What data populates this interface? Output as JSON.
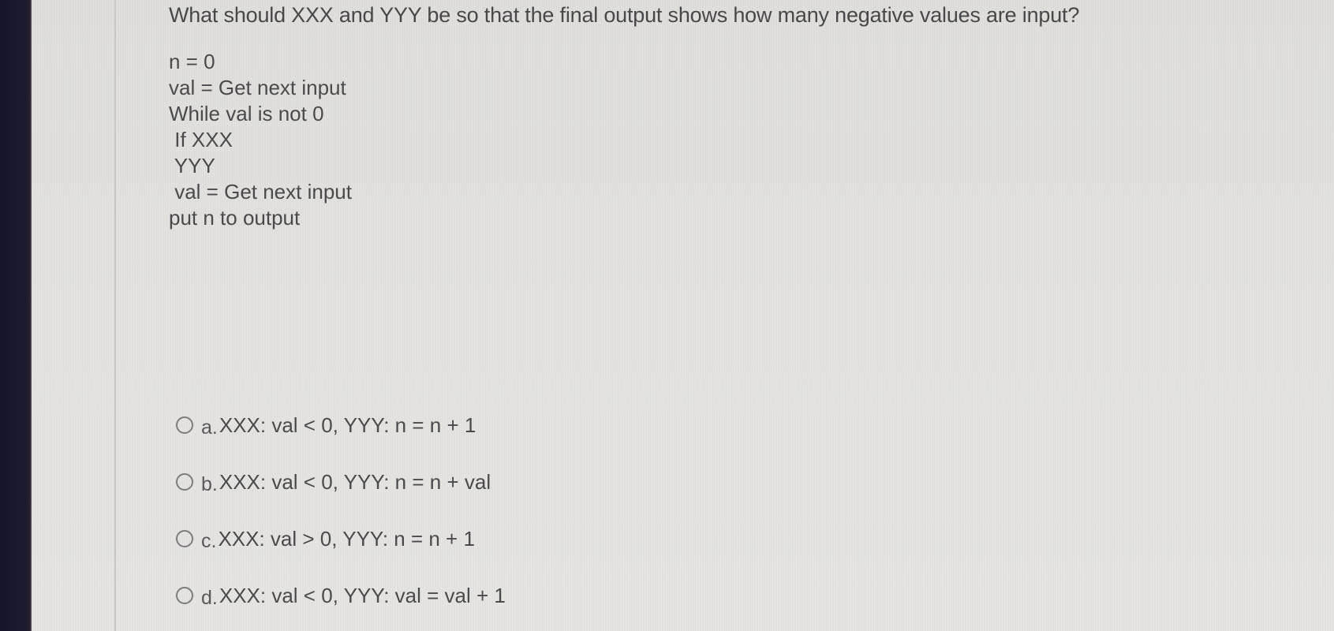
{
  "question": {
    "prompt": "What should XXX and YYY be so that the final output shows how many negative values are input?"
  },
  "code": {
    "lines": [
      "n = 0",
      "val = Get next input",
      "While val is not 0",
      " If XXX",
      " YYY",
      " val = Get next input",
      "put n to output"
    ]
  },
  "options": [
    {
      "letter": "a.",
      "text": "XXX: val < 0, YYY: n = n + 1",
      "selected": false
    },
    {
      "letter": "b.",
      "text": "XXX: val < 0, YYY: n = n + val",
      "selected": false
    },
    {
      "letter": "c.",
      "text": "XXX: val > 0, YYY: n = n + 1",
      "selected": false
    },
    {
      "letter": "d.",
      "text": "XXX: val < 0, YYY: val = val + 1",
      "selected": false
    }
  ]
}
